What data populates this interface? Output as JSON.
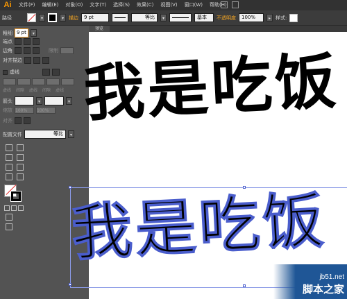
{
  "app": {
    "logo": "Ai"
  },
  "menu": [
    "文件(F)",
    "编辑(E)",
    "对象(O)",
    "文字(T)",
    "选择(S)",
    "效果(C)",
    "视图(V)",
    "窗口(W)",
    "帮助(H)"
  ],
  "control_bar": {
    "path_label": "路径",
    "stroke_label": "描边",
    "stroke_weight": "9 pt",
    "profile_label": "等比",
    "brush_label": "基本",
    "opacity_label": "不透明度",
    "opacity_value": "100%",
    "style_label": "样式:"
  },
  "stroke_panel": {
    "tab": "描边",
    "weight_label": "粗细",
    "weight_value": "9 pt",
    "cap_label": "端点",
    "corner_label": "边角",
    "limit_label": "限制",
    "align_label": "对齐描边",
    "dashed_label": "虚线",
    "dash_fields": [
      "虚线",
      "间隙",
      "虚线",
      "间隙",
      "虚线",
      "间隙"
    ],
    "arrow_label": "箭头",
    "scale_label": "缩放",
    "scale_a": "100%",
    "scale_b": "100%",
    "align2_label": "对齐",
    "profile_label": "配置文件",
    "profile_value": "等比"
  },
  "document": {
    "tab": "预览"
  },
  "artwork": {
    "top_text": "我是吃饭",
    "bottom_text": "我是吃饭"
  },
  "watermark": {
    "site": "jb51.net",
    "name": "脚本之家"
  },
  "colors": {
    "accent": "#f59a23",
    "selection": "#4a5dcc",
    "watermark_bg": "#1f5696"
  }
}
